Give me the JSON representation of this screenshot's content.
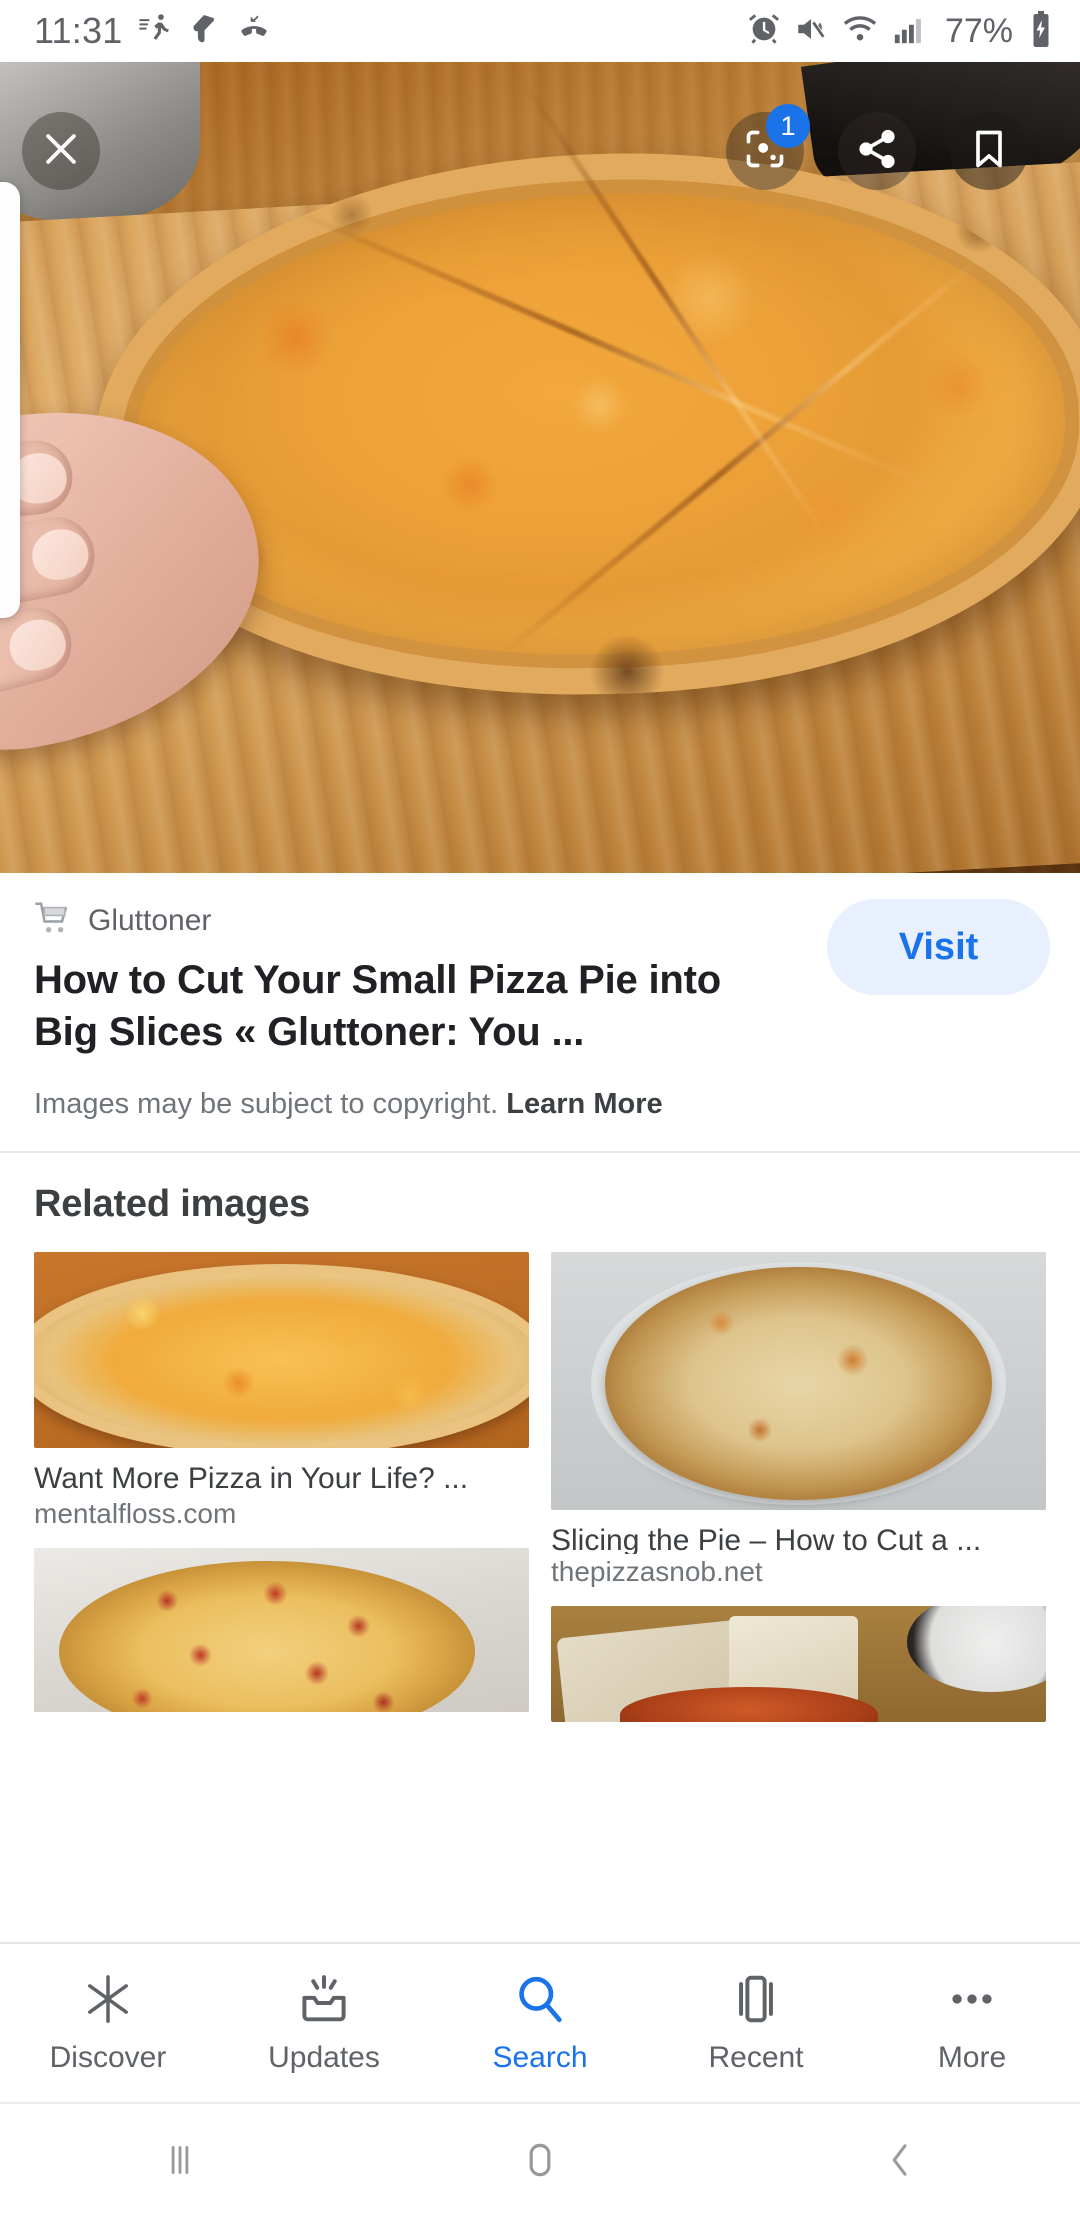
{
  "statusbar": {
    "time": "11:31",
    "battery_percent": "77%",
    "left_icons": [
      "activity-running-icon",
      "ink-drop-icon",
      "missed-call-icon"
    ],
    "right_icons": [
      "alarm-icon",
      "volume-mute-icon",
      "wifi-icon",
      "signal-bars-icon",
      "battery-charging-icon"
    ]
  },
  "hero": {
    "alt": "Large cheese pizza sliced into big triangular slices on a wooden cutting board, held by a hand",
    "close_icon": "close-icon",
    "lens_icon": "google-lens-icon",
    "lens_badge": "1",
    "share_icon": "share-icon",
    "bookmark_icon": "bookmark-icon"
  },
  "result": {
    "favicon": "shopping-cart-icon",
    "source": "Gluttoner",
    "title": "How to Cut Your Small Pizza Pie into Big Slices « Gluttoner: You ...",
    "copyright_text": "Images may be subject to copyright.",
    "learn_more": "Learn More",
    "visit_label": "Visit",
    "accent_color": "#1a73e8",
    "visit_bg_color": "#e8f0fe"
  },
  "related": {
    "heading": "Related images",
    "items": [
      {
        "caption": "Want More Pizza in Your Life? ...",
        "domain": "mentalfloss.com",
        "alt": "Whole cheese pizza on a wooden table"
      },
      {
        "caption": "Slicing the Pie – How to Cut a ...",
        "domain": "thepizzasnob.net",
        "alt": "Thin crust cheese pizza on a round metal pan"
      },
      {
        "caption": "",
        "domain": "",
        "alt": "Pepperoni pizza in an open cardboard box"
      },
      {
        "caption": "",
        "domain": "",
        "alt": "Pizza slice on parchment paper with a dark pan"
      }
    ]
  },
  "bottom_nav": {
    "items": [
      {
        "label": "Discover",
        "icon": "asterisk-icon",
        "active": false
      },
      {
        "label": "Updates",
        "icon": "inbox-updates-icon",
        "active": false
      },
      {
        "label": "Search",
        "icon": "search-icon",
        "active": true
      },
      {
        "label": "Recent",
        "icon": "recent-cards-icon",
        "active": false
      },
      {
        "label": "More",
        "icon": "more-ellipsis-icon",
        "active": false
      }
    ]
  },
  "system_nav": {
    "recents_icon": "recents-bars-icon",
    "home_icon": "home-icon",
    "back_icon": "back-chevron-icon"
  }
}
